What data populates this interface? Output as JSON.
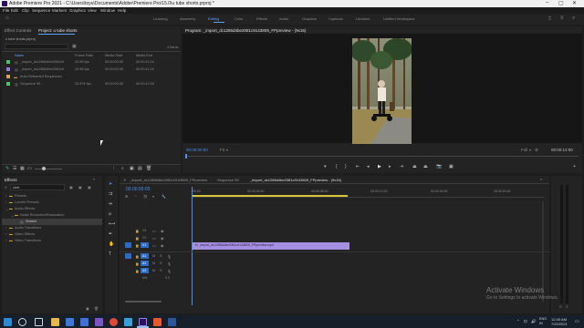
{
  "window": {
    "title": "Adobe Premiere Pro 2021 - C:\\Users\\toyu\\Documents\\Adobe\\Premiere Pro\\15.0\\u tube shorts.prproj *"
  },
  "menu": [
    "File",
    "Edit",
    "Clip",
    "Sequence",
    "Markers",
    "Graphics",
    "View",
    "Window",
    "Help"
  ],
  "workspaces": [
    "Learning",
    "Assembly",
    "Editing",
    "Color",
    "Effects",
    "Audio",
    "Graphics",
    "Captions",
    "Libraries",
    "Untitled Workspace"
  ],
  "active_workspace": "Editing",
  "project_panel": {
    "tabs": [
      "Effect Controls",
      "Project: u tube shorts"
    ],
    "file": "u tube shorts.prproj",
    "item_count": "4 Items",
    "columns": [
      "Name",
      "Frame Rate",
      "Media Start",
      "Media End"
    ],
    "rows": [
      {
        "name": "_import_dc1285d4be2081c9",
        "fps": "23.98 fps",
        "start": "00:00:00:00",
        "end": "00:00:11:24",
        "color": "#4fbf6f"
      },
      {
        "name": "_import_dc1285d4be2081c9",
        "fps": "23.98 fps",
        "start": "00:00:00:00",
        "end": "00:00:11:24",
        "color": "#9b77d9"
      },
      {
        "name": "Auto-Reframed Sequences",
        "fps": "",
        "start": "",
        "end": "",
        "color": "#d9a23a"
      },
      {
        "name": "Sequence 99",
        "fps": "23.976 fps",
        "start": "00:00:00:00",
        "end": "00:00:12:00",
        "color": "#4fbf6f"
      }
    ]
  },
  "program_monitor": {
    "title": "Program: _import_dc1285d4be2081c9143809_FPpreview - (9x16)",
    "timecode_left": "00:00:00:00",
    "fit": "Fit",
    "quality": "Full",
    "timecode_right": "00:00:12:00"
  },
  "effects_panel": {
    "title": "Effects",
    "search": "stret",
    "tree": [
      "Presets",
      "Lumetri Presets",
      "Audio Effects",
      "Noise Reduction/Restoration",
      "Stretch",
      "Audio Transitions",
      "Video Effects",
      "Video Transitions"
    ]
  },
  "timeline": {
    "tabs": [
      "_import_dc1285d4be2081c9143809_FPpreview",
      "Sequence 99",
      "_import_dc1285d4be2081c9143809_FPpreview - (9x16)"
    ],
    "timecode": "00:00:00:00",
    "ruler": [
      "00:00",
      "00:00:04:00",
      "00:00:08:00",
      "00:00:12:00",
      "00:00:16:00",
      "00:00:20:00"
    ],
    "video_tracks": [
      "V3",
      "V2",
      "V1"
    ],
    "audio_tracks": [
      "A1",
      "A2",
      "A3"
    ],
    "master": "Mix",
    "master_value": "0.0",
    "clip_label": "fx _import_dc1285d4be2081c9143809_FPpreview.mp4"
  },
  "activation": {
    "line1": "Activate Windows",
    "line2": "Go to Settings to activate Windows."
  },
  "taskbar": {
    "lang": "ENG\nIN",
    "time": "12:45 AM",
    "date": "7/22/2021"
  }
}
